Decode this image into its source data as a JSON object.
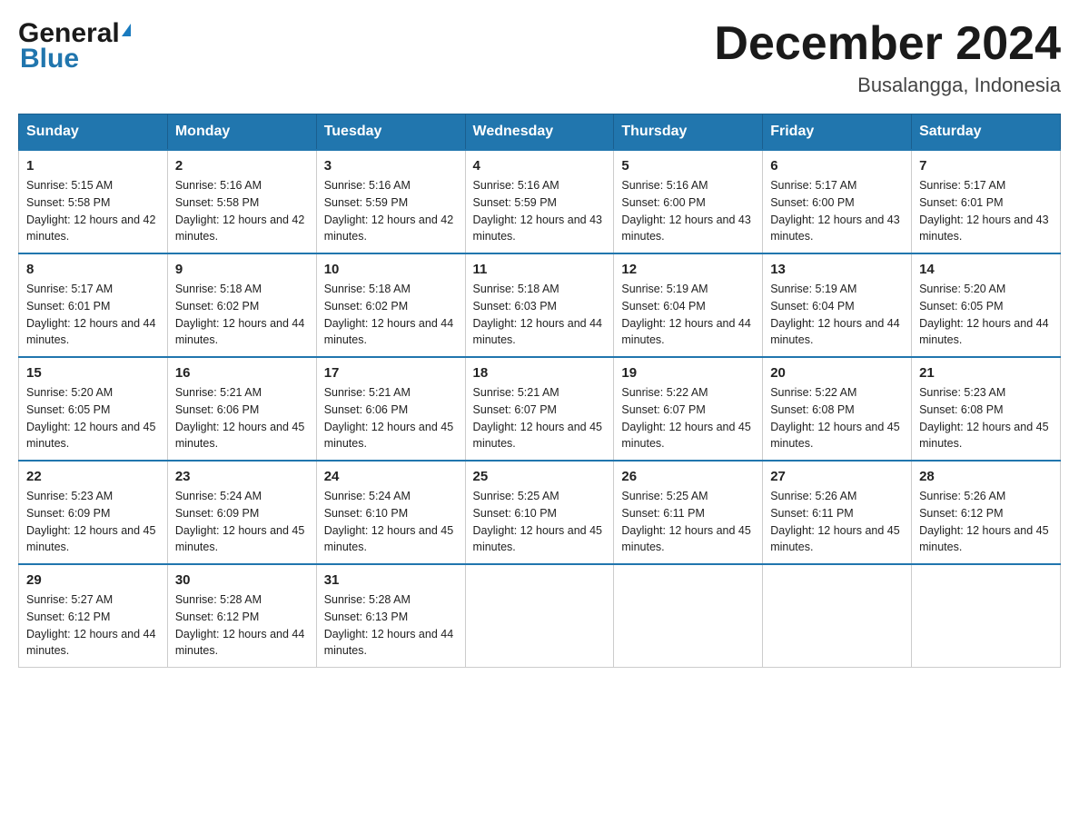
{
  "header": {
    "logo_general": "General",
    "logo_blue": "Blue",
    "month_title": "December 2024",
    "location": "Busalangga, Indonesia"
  },
  "weekdays": [
    "Sunday",
    "Monday",
    "Tuesday",
    "Wednesday",
    "Thursday",
    "Friday",
    "Saturday"
  ],
  "weeks": [
    [
      {
        "day": "1",
        "sunrise": "5:15 AM",
        "sunset": "5:58 PM",
        "daylight": "12 hours and 42 minutes."
      },
      {
        "day": "2",
        "sunrise": "5:16 AM",
        "sunset": "5:58 PM",
        "daylight": "12 hours and 42 minutes."
      },
      {
        "day": "3",
        "sunrise": "5:16 AM",
        "sunset": "5:59 PM",
        "daylight": "12 hours and 42 minutes."
      },
      {
        "day": "4",
        "sunrise": "5:16 AM",
        "sunset": "5:59 PM",
        "daylight": "12 hours and 43 minutes."
      },
      {
        "day": "5",
        "sunrise": "5:16 AM",
        "sunset": "6:00 PM",
        "daylight": "12 hours and 43 minutes."
      },
      {
        "day": "6",
        "sunrise": "5:17 AM",
        "sunset": "6:00 PM",
        "daylight": "12 hours and 43 minutes."
      },
      {
        "day": "7",
        "sunrise": "5:17 AM",
        "sunset": "6:01 PM",
        "daylight": "12 hours and 43 minutes."
      }
    ],
    [
      {
        "day": "8",
        "sunrise": "5:17 AM",
        "sunset": "6:01 PM",
        "daylight": "12 hours and 44 minutes."
      },
      {
        "day": "9",
        "sunrise": "5:18 AM",
        "sunset": "6:02 PM",
        "daylight": "12 hours and 44 minutes."
      },
      {
        "day": "10",
        "sunrise": "5:18 AM",
        "sunset": "6:02 PM",
        "daylight": "12 hours and 44 minutes."
      },
      {
        "day": "11",
        "sunrise": "5:18 AM",
        "sunset": "6:03 PM",
        "daylight": "12 hours and 44 minutes."
      },
      {
        "day": "12",
        "sunrise": "5:19 AM",
        "sunset": "6:04 PM",
        "daylight": "12 hours and 44 minutes."
      },
      {
        "day": "13",
        "sunrise": "5:19 AM",
        "sunset": "6:04 PM",
        "daylight": "12 hours and 44 minutes."
      },
      {
        "day": "14",
        "sunrise": "5:20 AM",
        "sunset": "6:05 PM",
        "daylight": "12 hours and 44 minutes."
      }
    ],
    [
      {
        "day": "15",
        "sunrise": "5:20 AM",
        "sunset": "6:05 PM",
        "daylight": "12 hours and 45 minutes."
      },
      {
        "day": "16",
        "sunrise": "5:21 AM",
        "sunset": "6:06 PM",
        "daylight": "12 hours and 45 minutes."
      },
      {
        "day": "17",
        "sunrise": "5:21 AM",
        "sunset": "6:06 PM",
        "daylight": "12 hours and 45 minutes."
      },
      {
        "day": "18",
        "sunrise": "5:21 AM",
        "sunset": "6:07 PM",
        "daylight": "12 hours and 45 minutes."
      },
      {
        "day": "19",
        "sunrise": "5:22 AM",
        "sunset": "6:07 PM",
        "daylight": "12 hours and 45 minutes."
      },
      {
        "day": "20",
        "sunrise": "5:22 AM",
        "sunset": "6:08 PM",
        "daylight": "12 hours and 45 minutes."
      },
      {
        "day": "21",
        "sunrise": "5:23 AM",
        "sunset": "6:08 PM",
        "daylight": "12 hours and 45 minutes."
      }
    ],
    [
      {
        "day": "22",
        "sunrise": "5:23 AM",
        "sunset": "6:09 PM",
        "daylight": "12 hours and 45 minutes."
      },
      {
        "day": "23",
        "sunrise": "5:24 AM",
        "sunset": "6:09 PM",
        "daylight": "12 hours and 45 minutes."
      },
      {
        "day": "24",
        "sunrise": "5:24 AM",
        "sunset": "6:10 PM",
        "daylight": "12 hours and 45 minutes."
      },
      {
        "day": "25",
        "sunrise": "5:25 AM",
        "sunset": "6:10 PM",
        "daylight": "12 hours and 45 minutes."
      },
      {
        "day": "26",
        "sunrise": "5:25 AM",
        "sunset": "6:11 PM",
        "daylight": "12 hours and 45 minutes."
      },
      {
        "day": "27",
        "sunrise": "5:26 AM",
        "sunset": "6:11 PM",
        "daylight": "12 hours and 45 minutes."
      },
      {
        "day": "28",
        "sunrise": "5:26 AM",
        "sunset": "6:12 PM",
        "daylight": "12 hours and 45 minutes."
      }
    ],
    [
      {
        "day": "29",
        "sunrise": "5:27 AM",
        "sunset": "6:12 PM",
        "daylight": "12 hours and 44 minutes."
      },
      {
        "day": "30",
        "sunrise": "5:28 AM",
        "sunset": "6:12 PM",
        "daylight": "12 hours and 44 minutes."
      },
      {
        "day": "31",
        "sunrise": "5:28 AM",
        "sunset": "6:13 PM",
        "daylight": "12 hours and 44 minutes."
      },
      null,
      null,
      null,
      null
    ]
  ]
}
